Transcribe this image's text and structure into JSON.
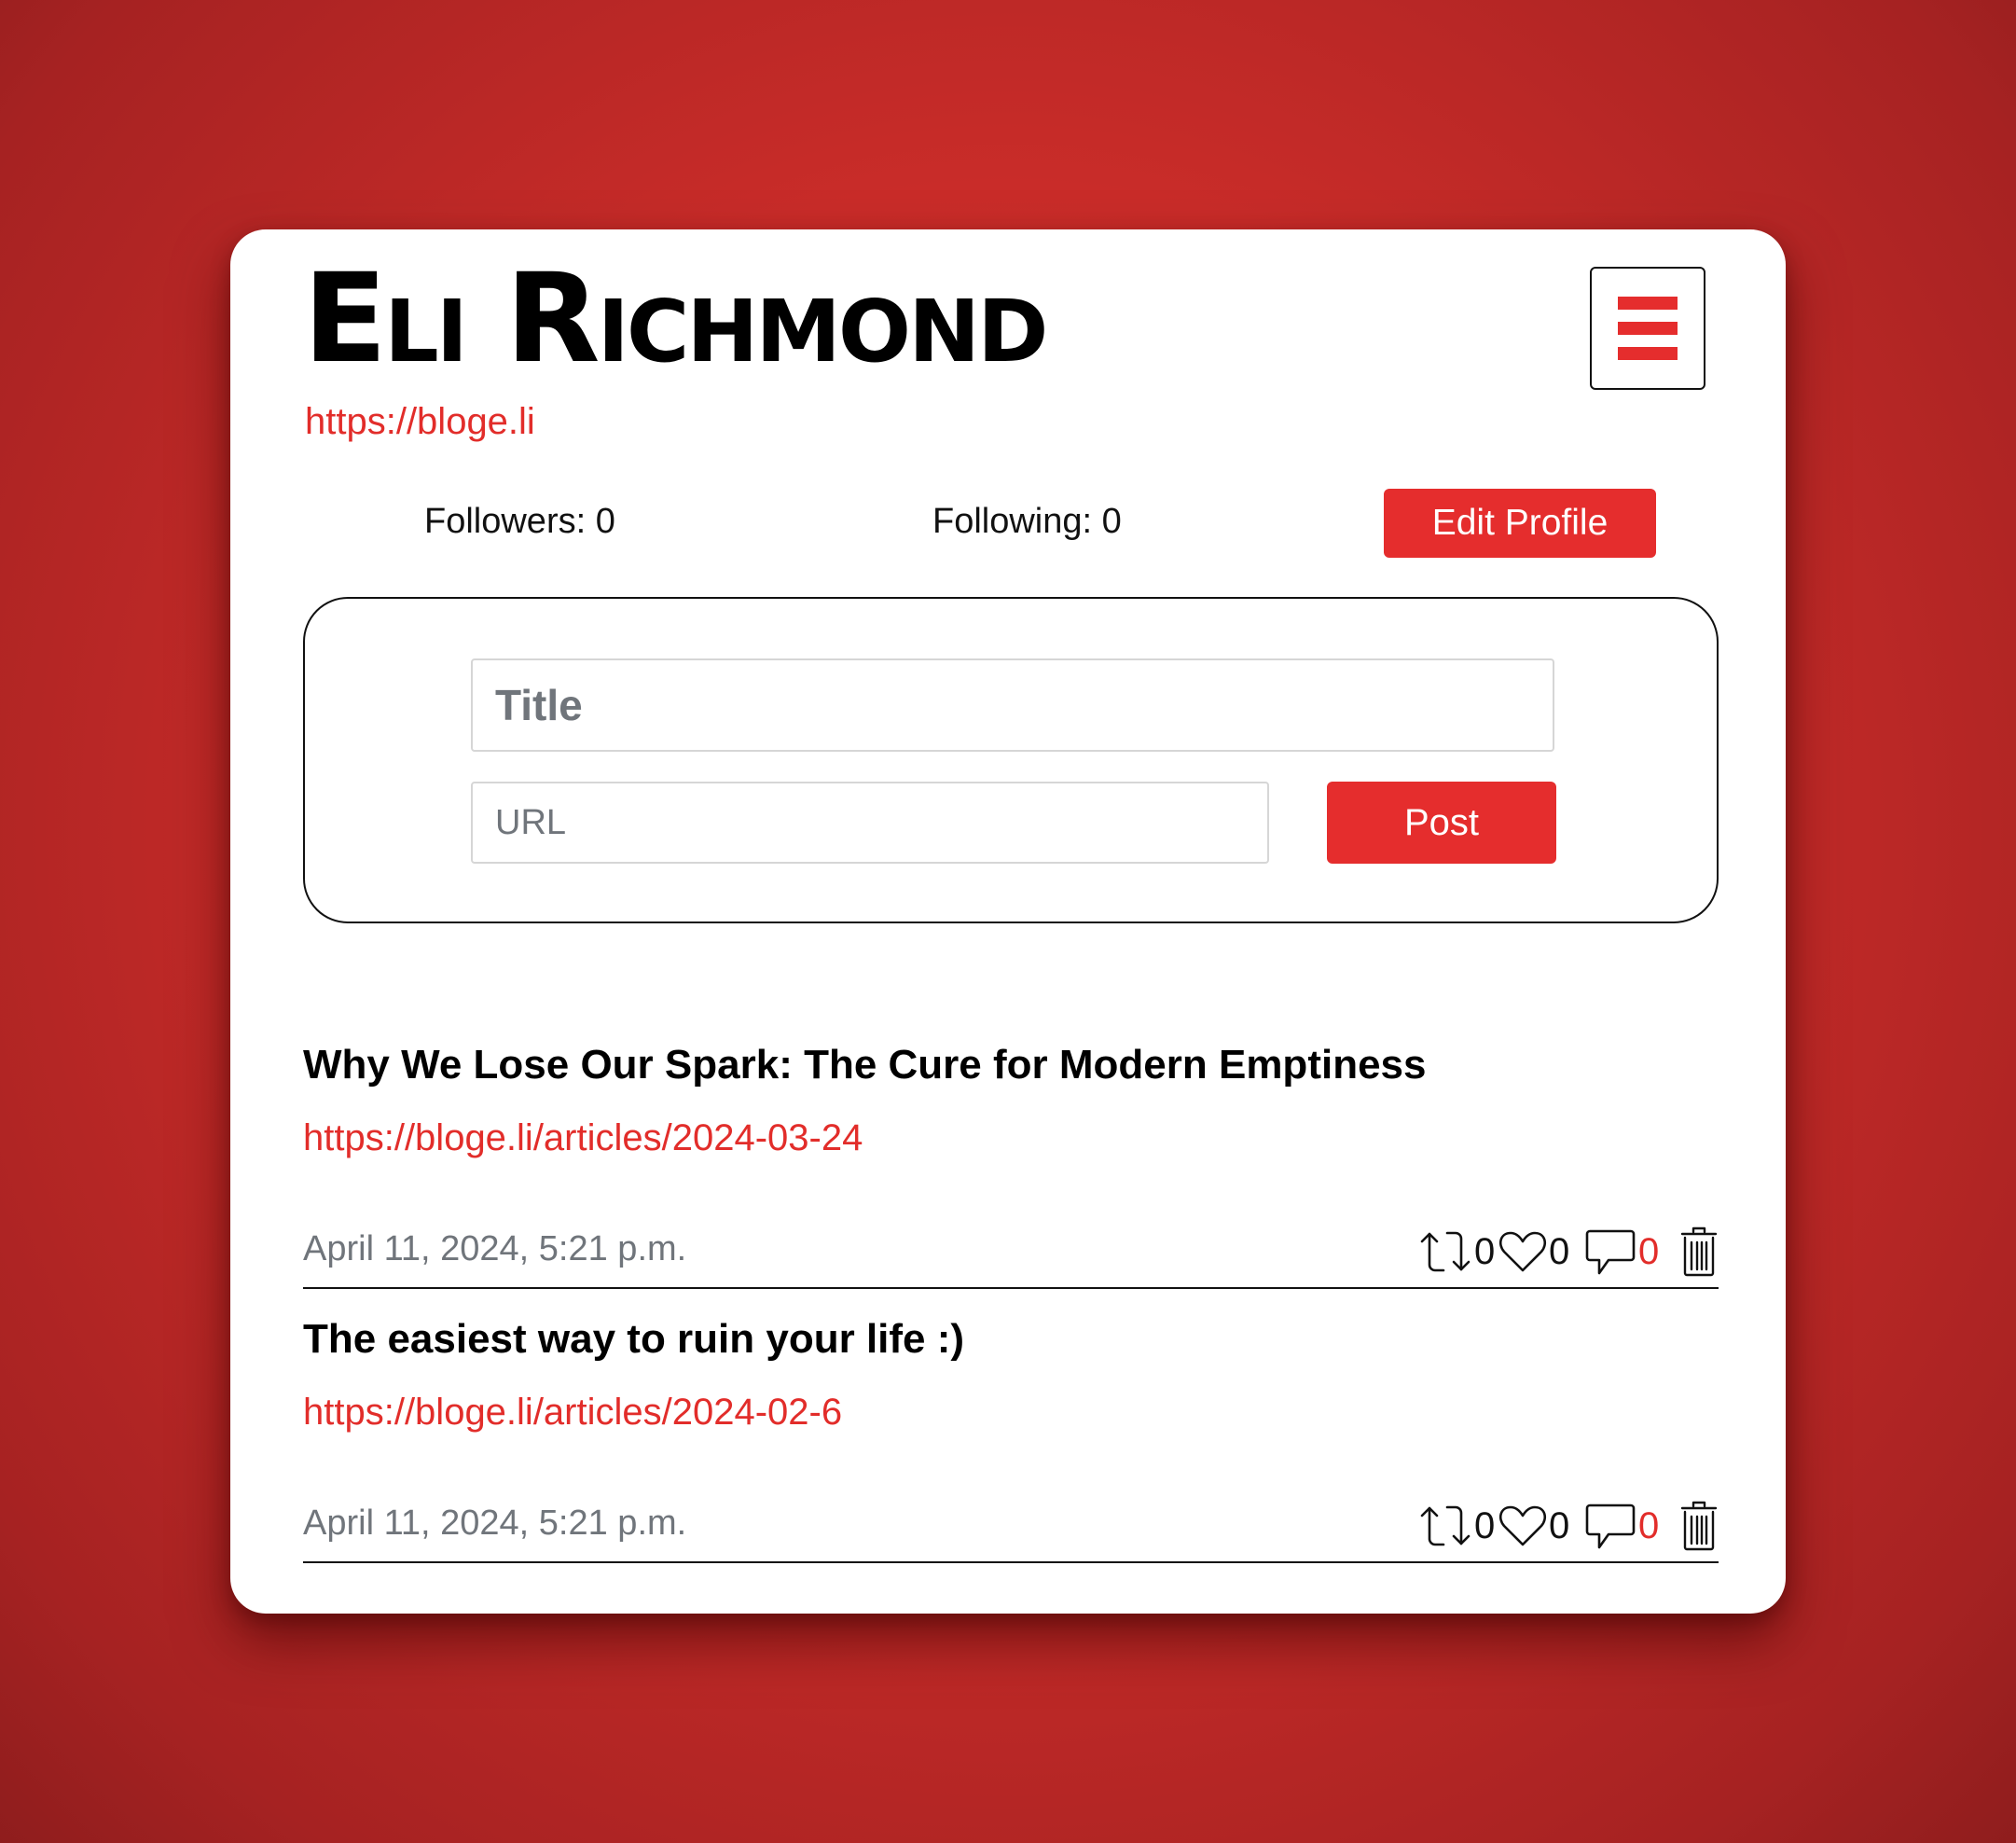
{
  "profile": {
    "name": "Eli Richmond",
    "url": "https://bloge.li",
    "followers_label": "Followers: 0",
    "following_label": "Following: 0",
    "edit_button": "Edit Profile"
  },
  "menu": {
    "icon": "hamburger-icon",
    "color": "#e52d2d"
  },
  "composer": {
    "title_placeholder": "Title",
    "url_placeholder": "URL",
    "post_button": "Post"
  },
  "posts": [
    {
      "title": "Why We Lose Our Spark: The Cure for Modern Emptiness",
      "url": "https://bloge.li/articles/2024-03-24",
      "date": "April 11, 2024, 5:21 p.m.",
      "reposts": "0",
      "likes": "0",
      "comments": "0"
    },
    {
      "title": "The easiest way to ruin your life :)",
      "url": "https://bloge.li/articles/2024-02-6",
      "date": "April 11, 2024, 5:21 p.m.",
      "reposts": "0",
      "likes": "0",
      "comments": "0"
    }
  ],
  "icons": {
    "repost": "repost-icon",
    "like": "heart-icon",
    "comment": "comment-icon",
    "delete": "trash-icon"
  },
  "colors": {
    "accent": "#e52d2d",
    "background": "#c92c29",
    "muted_text": "#70757b"
  }
}
